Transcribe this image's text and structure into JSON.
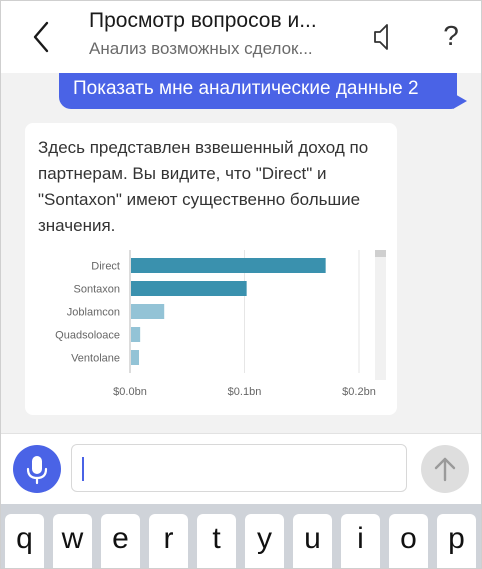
{
  "header": {
    "title": "Просмотр вопросов и...",
    "subtitle": "Анализ возможных сделок...",
    "help_label": "?"
  },
  "conversation": {
    "user_message": "Показать мне аналитические данные 2",
    "bot_message": "Здесь представлен взвешенный доход по партнерам. Вы видите, что \"Direct\" и \"Sontaxon\" имеют существенно большие значения."
  },
  "chart_data": {
    "type": "bar",
    "orientation": "horizontal",
    "categories": [
      "Direct",
      "Sontaxon",
      "Joblamcon",
      "Quadsoloace",
      "Ventolane"
    ],
    "values": [
      0.17,
      0.101,
      0.029,
      0.008,
      0.007
    ],
    "xlim": [
      0,
      0.2
    ],
    "x_ticks": [
      0,
      0.1,
      0.2
    ],
    "x_tick_labels": [
      "$0.0bn",
      "$0.1bn",
      "$0.2bn"
    ],
    "grid": true,
    "colors": [
      "#3a91ae",
      "#3a91ae",
      "#93c3d6",
      "#93c3d6",
      "#93c3d6"
    ]
  },
  "input": {
    "value": "",
    "placeholder": ""
  },
  "keyboard": {
    "keys": [
      "q",
      "w",
      "e",
      "r",
      "t",
      "y",
      "u",
      "i",
      "o",
      "p"
    ]
  },
  "colors": {
    "accent": "#4a63e6",
    "bar_primary": "#3a91ae",
    "bar_secondary": "#93c3d6"
  }
}
